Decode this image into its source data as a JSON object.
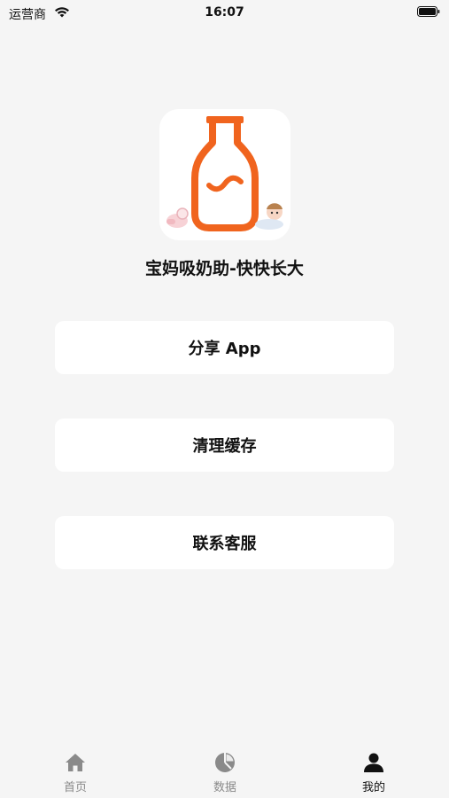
{
  "status_bar": {
    "carrier": "运营商",
    "time": "16:07"
  },
  "app": {
    "name": "宝妈吸奶助-快快长大",
    "icon": "baby-bottle-icon",
    "accent_color": "#f0641e"
  },
  "menu": {
    "share_label": "分享 App",
    "clear_cache_label": "清理缓存",
    "contact_label": "联系客服"
  },
  "tab_bar": {
    "items": [
      {
        "label": "首页",
        "icon": "home-icon",
        "active": false
      },
      {
        "label": "数据",
        "icon": "pie-chart-icon",
        "active": false
      },
      {
        "label": "我的",
        "icon": "person-icon",
        "active": true
      }
    ]
  }
}
